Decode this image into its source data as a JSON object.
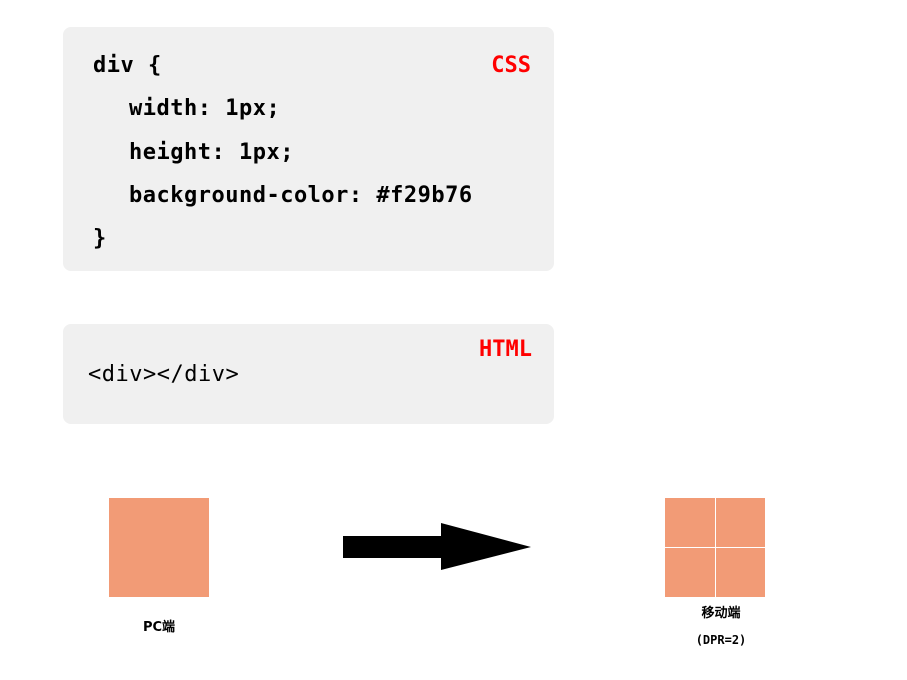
{
  "css_block": {
    "lang_label": "CSS",
    "lines": [
      "div {",
      "width: 1px;",
      "height: 1px;",
      "background-color: #f29b76",
      "}"
    ]
  },
  "html_block": {
    "lang_label": "HTML",
    "code": "<div></div>"
  },
  "pc": {
    "caption": "PC端",
    "color": "#f29b76"
  },
  "mobile": {
    "caption": "移动端",
    "subcaption": "(DPR=2)",
    "color": "#f29b76"
  },
  "colors": {
    "code_bg": "#f0f0f0",
    "lang_label": "#ff0000",
    "square_fill": "#f29b76",
    "arrow": "#000000"
  }
}
